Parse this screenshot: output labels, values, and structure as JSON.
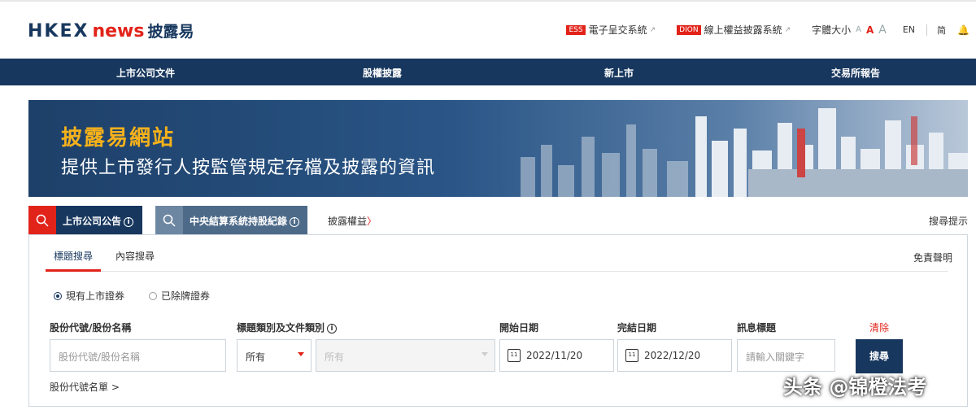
{
  "brand": {
    "hkex": "HKEX",
    "news": "news",
    "zh": "披露易"
  },
  "top_links": {
    "ess_badge": "ESS",
    "ess_label": "電子呈交系統",
    "dion_badge": "DION",
    "dion_label": "線上權益披露系統",
    "font_size_label": "字體大小",
    "font_a1": "A",
    "font_a2": "A",
    "font_a3": "A",
    "lang_en": "EN",
    "lang_sc": "简"
  },
  "nav": [
    "上市公司文件",
    "股權披露",
    "新上市",
    "交易所報告"
  ],
  "banner": {
    "title": "披露易網站",
    "subtitle": "提供上市發行人按監管規定存檔及披露的資訊"
  },
  "search_tabs": {
    "tab1": "上市公司公告",
    "tab2": "中央結算系統持股紀錄",
    "tab3": "披露權益",
    "tab3_chev": "〉",
    "hint": "搜尋提示",
    "info": "i"
  },
  "subtabs": {
    "title_search": "標題搜尋",
    "content_search": "內容搜尋",
    "disclaimer": "免責聲明"
  },
  "radios": {
    "current": "現有上市證券",
    "delisted": "已除牌證券"
  },
  "form": {
    "stock_label": "股份代號/股份名稱",
    "stock_placeholder": "股份代號/股份名稱",
    "category_label": "標題類別及文件類別",
    "category_value": "所有",
    "doc_value": "所有",
    "start_label": "開始日期",
    "start_date": "2022/11/20",
    "end_label": "完結日期",
    "end_date": "2022/12/20",
    "headline_label": "訊息標題",
    "headline_placeholder": "請輸入關鍵字",
    "clear": "清除",
    "search": "搜尋",
    "code_list": "股份代號名單 >",
    "cal_day": "11"
  },
  "watermark": "头条 @锦橙法考",
  "colors": {
    "navy": "#17375e",
    "red": "#e2231a",
    "gold": "#f6b11b"
  }
}
